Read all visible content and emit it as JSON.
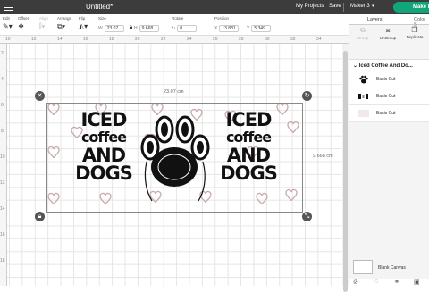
{
  "app": {
    "title": "Untitled*",
    "my_projects": "My Projects",
    "save": "Save",
    "machine": "Maker 3",
    "make_it": "Make It"
  },
  "toolbar": {
    "edit": "Edit",
    "offset": "Offset",
    "align": "Align",
    "arrange": "Arrange",
    "flip": "Flip",
    "size": "Size",
    "rotate": "Rotate",
    "position": "Position",
    "w_label": "W",
    "w_value": "23.07",
    "h_label": "H",
    "h_value": "9.668",
    "rotate_value": "0",
    "x_label": "X",
    "x_value": "13.881",
    "y_label": "Y",
    "y_value": "5.349"
  },
  "rulers": {
    "top": [
      "10",
      "12",
      "14",
      "16",
      "18",
      "20",
      "22",
      "24",
      "26",
      "28",
      "30",
      "32",
      "34"
    ],
    "left": [
      "2",
      "4",
      "6",
      "8",
      "10",
      "12",
      "14",
      "16",
      "18"
    ]
  },
  "canvas": {
    "width_label": "23.07 cm",
    "height_label": "9.668 cm",
    "design_text_left": [
      "ICED",
      "coffee",
      "AND",
      "DOGS"
    ],
    "design_text_right": [
      "ICED",
      "coffee",
      "AND",
      "DOGS"
    ]
  },
  "panel": {
    "tab_layers": "Layers",
    "tab_color": "Color S",
    "group_action": "Group",
    "ungroup_action": "UnGroup",
    "duplicate_action": "Duplicate",
    "group_name": "Iced Coffee And Do...",
    "layers": [
      {
        "label": "Basic Cut"
      },
      {
        "label": "Basic Cut"
      },
      {
        "label": "Basic Cut"
      }
    ],
    "blank_canvas": "Blank Canvas"
  }
}
